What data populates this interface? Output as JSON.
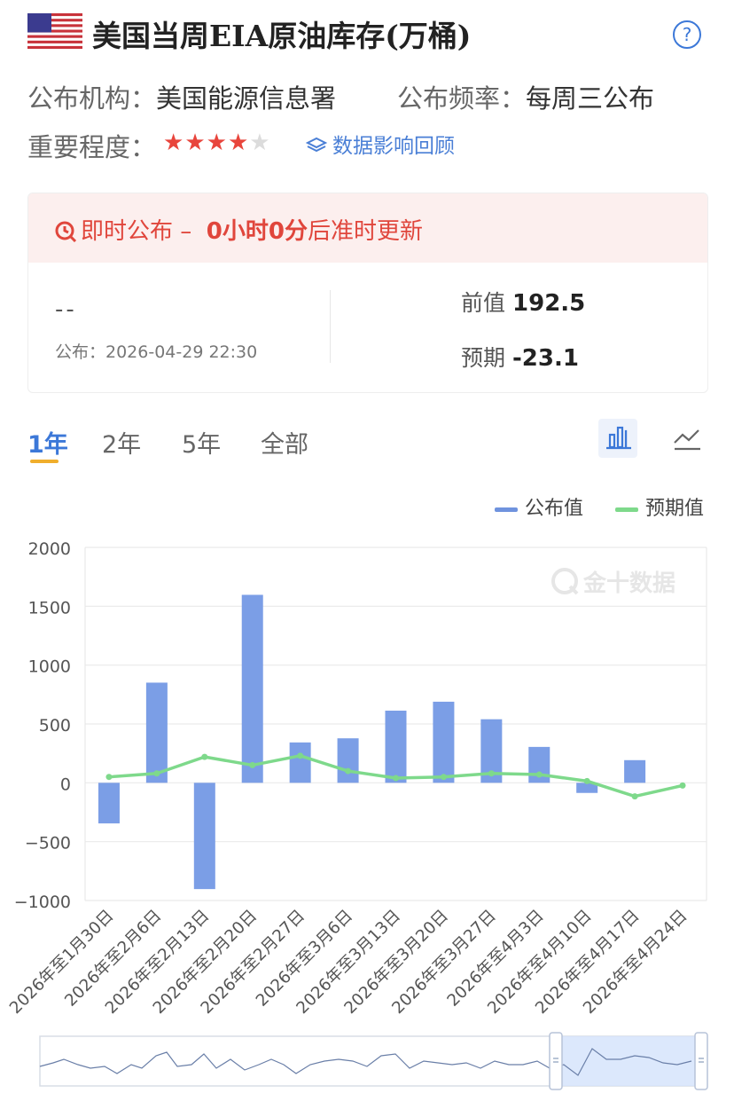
{
  "header": {
    "flag_icon": "us-flag-icon",
    "title": "美国当周EIA原油库存(万桶)",
    "help_icon": "question-circle-icon",
    "help_glyph": "?"
  },
  "meta": {
    "agency_label": "公布机构：",
    "agency": "美国能源信息署",
    "frequency_label": "公布频率：",
    "frequency": "每周三公布",
    "importance_label": "重要程度：",
    "importance_stars": 4,
    "importance_max": 5,
    "review_icon": "layers-icon",
    "review_link": "数据影响回顾"
  },
  "card": {
    "banner_icon": "refresh-clock-icon",
    "banner_prefix": "即时公布 –",
    "banner_countdown": "0小时0分",
    "banner_suffix": "后准时更新",
    "actual": "--",
    "publish_time": "公布：2026-04-29 22:30",
    "previous_label": "前值",
    "previous": "192.5",
    "forecast_label": "预期",
    "forecast": "-23.1"
  },
  "tabs": [
    {
      "label": "1年",
      "active": true
    },
    {
      "label": "2年",
      "active": false
    },
    {
      "label": "5年",
      "active": false
    },
    {
      "label": "全部",
      "active": false
    }
  ],
  "view_icons": [
    "bar-chart-icon",
    "line-chart-icon"
  ],
  "colors": {
    "bar": "#7b9ee6",
    "line": "#7ed98b",
    "accent": "#3c78d8",
    "star": "#e8453c",
    "banner_bg": "#fcefee"
  },
  "watermark": "金十数据",
  "chart_data": {
    "type": "bar",
    "categories": [
      "2026年至1月30日",
      "2026年至2月6日",
      "2026年至2月13日",
      "2026年至2月20日",
      "2026年至2月27日",
      "2026年至3月6日",
      "2026年至3月13日",
      "2026年至3月20日",
      "2026年至3月27日",
      "2026年至4月3日",
      "2026年至4月10日",
      "2026年至4月17日",
      "2026年至4月24日"
    ],
    "series": [
      {
        "name": "公布值",
        "type": "bar",
        "values": [
          -345,
          851,
          -903,
          1597,
          343,
          378,
          613,
          689,
          540,
          305,
          -86,
          192.5,
          null
        ]
      },
      {
        "name": "预期值",
        "type": "line",
        "values": [
          50,
          80,
          220,
          150,
          230,
          100,
          40,
          50,
          80,
          70,
          15,
          -115,
          -23.1
        ]
      }
    ],
    "yticks": [
      "2000",
      "1500",
      "1000",
      "500",
      "0",
      "−500",
      "−1000"
    ],
    "ylim": [
      -1000,
      2000
    ],
    "grid": true,
    "legend_position": "top-right"
  }
}
